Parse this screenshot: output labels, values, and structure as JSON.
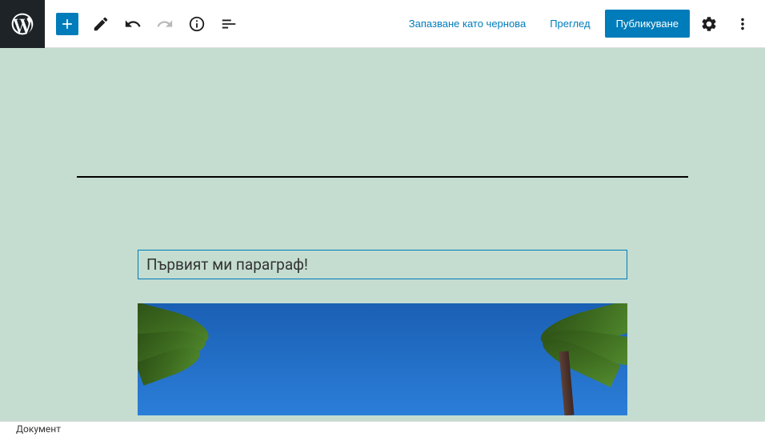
{
  "toolbar": {
    "save_draft": "Запазване като чернова",
    "preview": "Преглед",
    "publish": "Публикуване"
  },
  "editor": {
    "paragraph_text": "Първият ми параграф!"
  },
  "status": {
    "breadcrumb": "Документ"
  },
  "colors": {
    "accent": "#007cba",
    "canvas_bg": "#c4ddd0"
  }
}
